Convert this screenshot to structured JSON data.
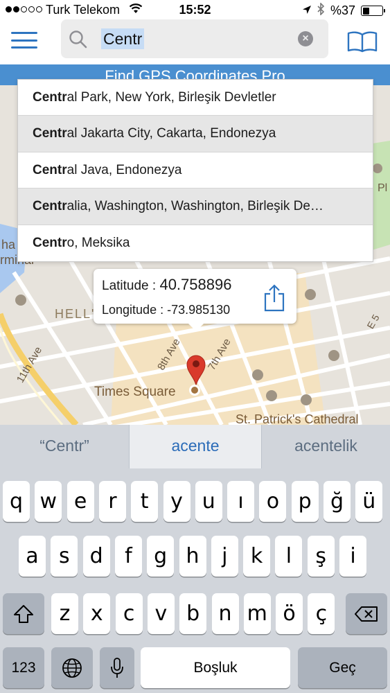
{
  "status_bar": {
    "carrier": "Turk Telekom",
    "time": "15:52",
    "battery": "%37",
    "battery_level": 0.37
  },
  "search": {
    "value": "Centr"
  },
  "map": {
    "banner": "Find GPS Coordinates Pro",
    "labels": [
      "HELL'S",
      "8th Ave",
      "7th Ave",
      "11th Ave",
      "Times Square",
      "St. Patrick's Cathedral",
      "E 5",
      "rminal",
      "ha",
      "Pl"
    ]
  },
  "suggestions": [
    {
      "bold": "Centr",
      "rest": "al Park, New York, Birleşik Devletler"
    },
    {
      "bold": "Centr",
      "rest": "al Jakarta City, Cakarta, Endonezya"
    },
    {
      "bold": "Centr",
      "rest": "al Java, Endonezya"
    },
    {
      "bold": "Centr",
      "rest": "alia, Washington, Washington, Birleşik De…"
    },
    {
      "bold": "Centr",
      "rest": "o, Meksika"
    }
  ],
  "callout": {
    "lat_label": "Latitude : ",
    "lat_value": "40.758896",
    "lon_label": "Longitude : ",
    "lon_value": "-73.985130"
  },
  "keyboard": {
    "predictions": [
      "“Centr”",
      "acente",
      "acentelik"
    ],
    "row1": [
      "q",
      "w",
      "e",
      "r",
      "t",
      "y",
      "u",
      "ı",
      "o",
      "p",
      "ğ",
      "ü"
    ],
    "row2": [
      "a",
      "s",
      "d",
      "f",
      "g",
      "h",
      "j",
      "k",
      "l",
      "ş",
      "i"
    ],
    "row3": [
      "z",
      "x",
      "c",
      "v",
      "b",
      "n",
      "m",
      "ö",
      "ç"
    ],
    "numbers_key": "123",
    "space_key": "Boşluk",
    "go_key": "Geç"
  },
  "colors": {
    "accent": "#2d74c0",
    "banner": "#4a8fd0",
    "pin": "#d93a2b",
    "keyboard_bg": "#d1d5db"
  }
}
